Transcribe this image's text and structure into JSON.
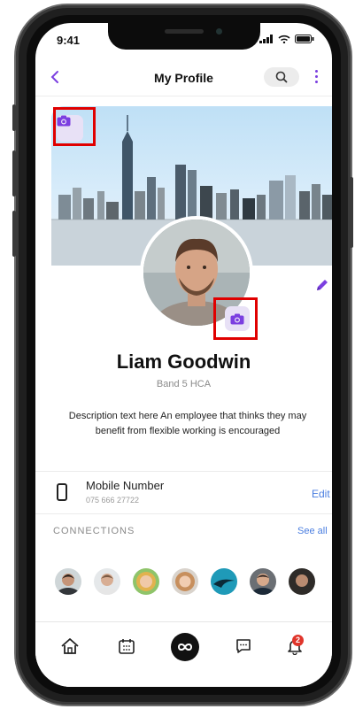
{
  "status_bar": {
    "time": "9:41"
  },
  "header": {
    "title": "My Profile"
  },
  "profile": {
    "name": "Liam Goodwin",
    "role": "Band 5 HCA",
    "description": "Description text here An employee that thinks they may benefit from flexible working is encouraged"
  },
  "contact": {
    "mobile_label": "Mobile Number",
    "mobile_number": "075 666 27722",
    "edit_label": "Edit"
  },
  "connections": {
    "heading": "CONNECTIONS",
    "see_all_label": "See all",
    "avatar_colors": [
      "#5b5148",
      "#b8a69a",
      "#d9a34a",
      "#c08a5c",
      "#1f9ab8",
      "#6b6f74",
      "#2e2b28"
    ]
  },
  "tabbar": {
    "items": [
      "home-icon",
      "calendar-icon",
      "infinity-icon",
      "chat-icon",
      "bell-icon"
    ],
    "notification_count": "2"
  },
  "colors": {
    "accent": "#7b3fe0",
    "link": "#4a7ee0",
    "highlight": "#e00000",
    "badge": "#e0352b"
  }
}
